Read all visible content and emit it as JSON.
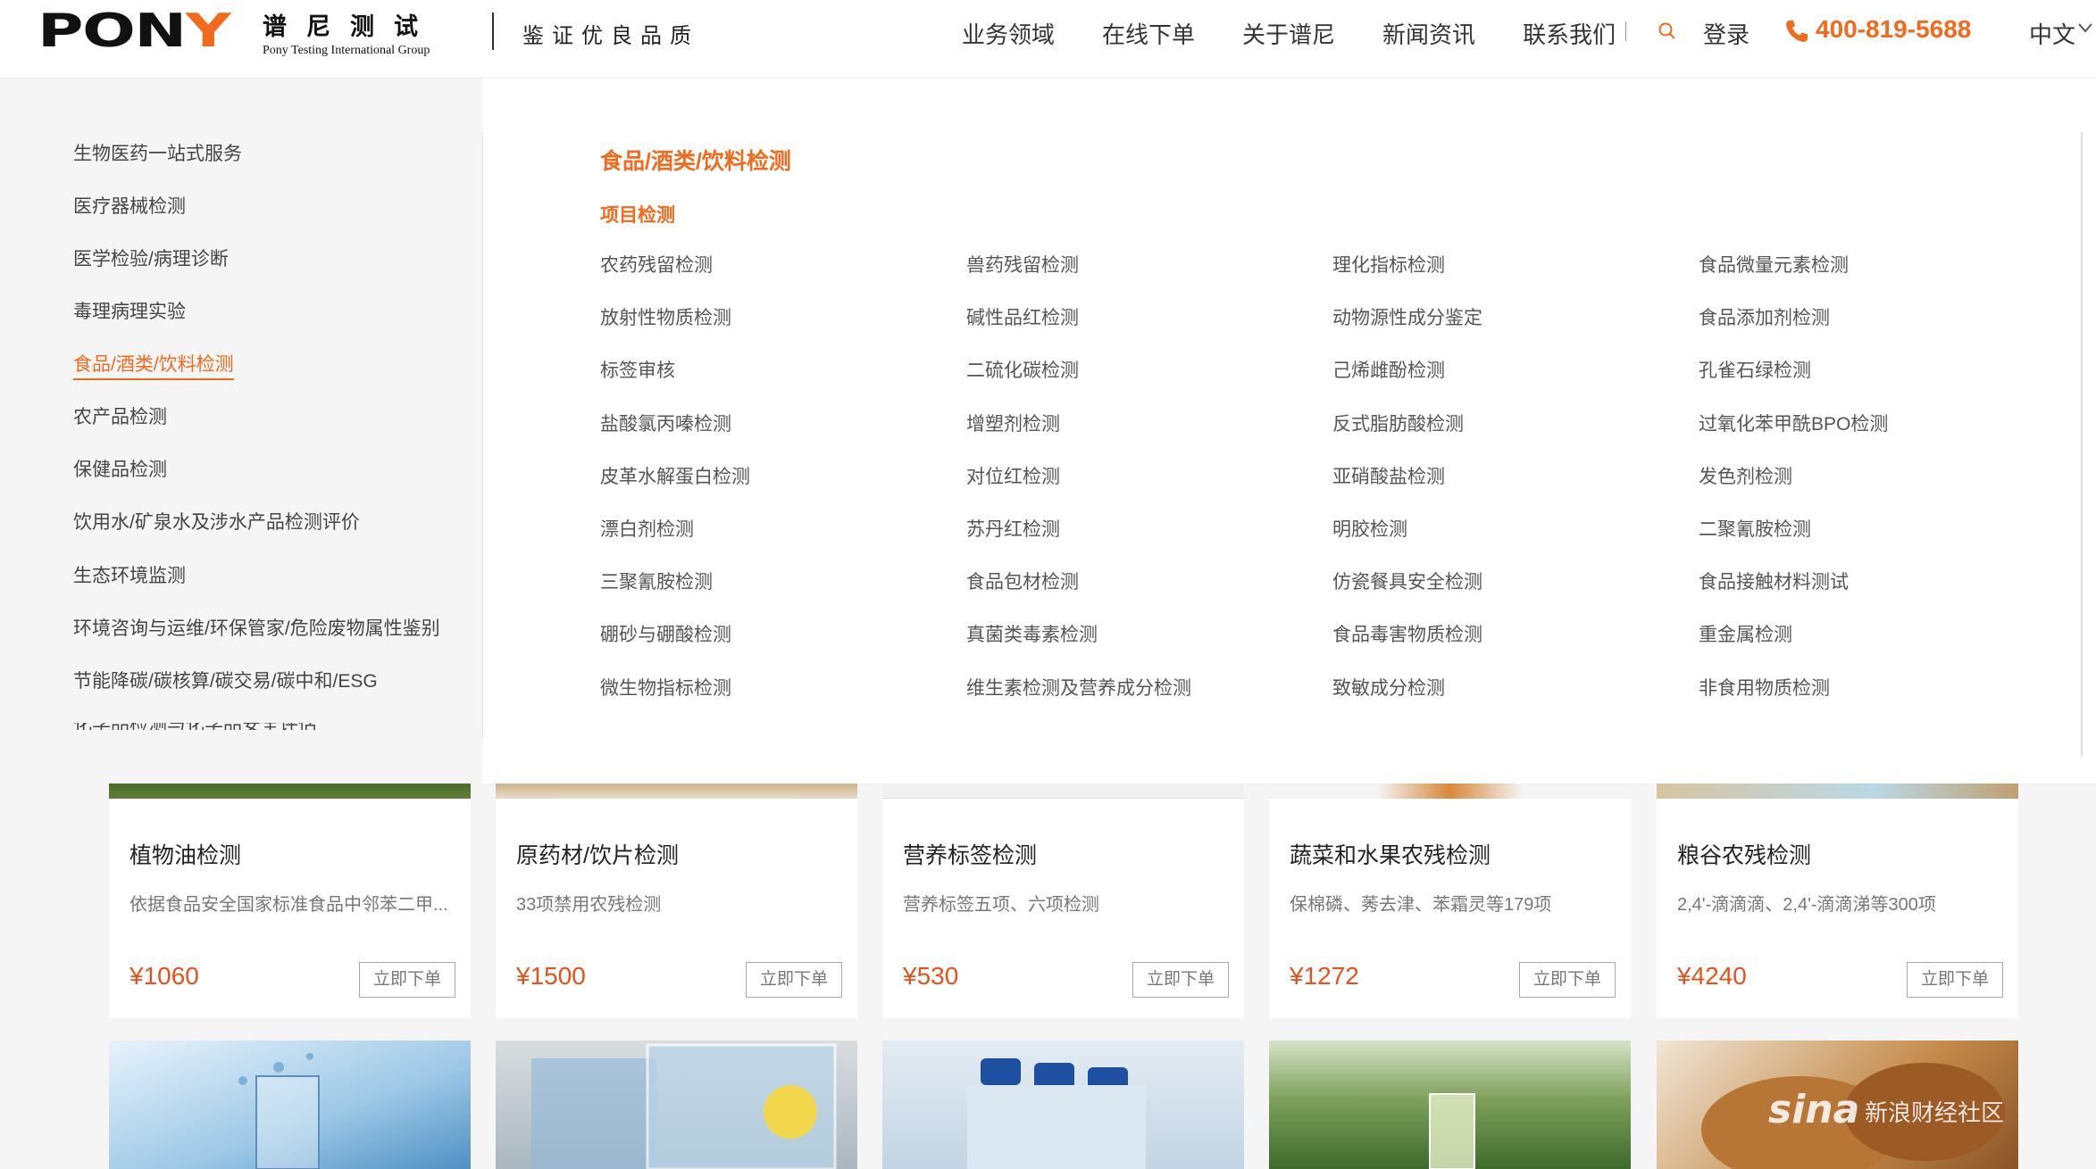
{
  "header": {
    "logo_text": "PONY",
    "logo_cn": "谱尼测试",
    "logo_en": "Pony Testing International Group",
    "slogan": "鉴证优良品质",
    "nav": [
      "业务领域",
      "在线下单",
      "关于谱尼",
      "新闻资讯",
      "联系我们"
    ],
    "login": "登录",
    "phone": "400-819-5688",
    "lang": "中文",
    "accent": "#f26a1b"
  },
  "sidebar": {
    "items": [
      "生物医药一站式服务",
      "医疗器械检测",
      "医学检验/病理诊断",
      "毒理病理实验",
      "食品/酒类/饮料检测",
      "农产品检测",
      "保健品检测",
      "饮用水/矿泉水及涉水产品检测评价",
      "生态环境监测",
      "环境咨询与运维/环保管家/危险废物属性鉴别",
      "节能降碳/碳核算/碳交易/碳中和/ESG"
    ],
    "active_index": 4,
    "partial_item": "化学品检测与化学品安全评估"
  },
  "mega": {
    "title": "食品/酒类/饮料检测",
    "subtitle": "项目检测",
    "items": [
      "农药残留检测",
      "兽药残留检测",
      "理化指标检测",
      "食品微量元素检测",
      "放射性物质检测",
      "碱性品红检测",
      "动物源性成分鉴定",
      "食品添加剂检测",
      "标签审核",
      "二硫化碳检测",
      "己烯雌酚检测",
      "孔雀石绿检测",
      "盐酸氯丙嗪检测",
      "增塑剂检测",
      "反式脂肪酸检测",
      "过氧化苯甲酰BPO检测",
      "皮革水解蛋白检测",
      "对位红检测",
      "亚硝酸盐检测",
      "发色剂检测",
      "漂白剂检测",
      "苏丹红检测",
      "明胶检测",
      "二聚氰胺检测",
      "三聚氰胺检测",
      "食品包材检测",
      "仿瓷餐具安全检测",
      "食品接触材料测试",
      "硼砂与硼酸检测",
      "真菌类毒素检测",
      "食品毒害物质检测",
      "重金属检测",
      "微生物指标检测",
      "维生素检测及营养成分检测",
      "致敏成分检测",
      "非食用物质检测"
    ]
  },
  "cards": [
    {
      "title": "植物油检测",
      "desc": "依据食品安全国家标准食品中邻苯二甲...",
      "price": "¥1060",
      "button": "立即下单"
    },
    {
      "title": "原药材/饮片检测",
      "desc": "33项禁用农残检测",
      "price": "¥1500",
      "button": "立即下单"
    },
    {
      "title": "营养标签检测",
      "desc": "营养标签五项、六项检测",
      "price": "¥530",
      "button": "立即下单"
    },
    {
      "title": "蔬菜和水果农残检测",
      "desc": "保棉磷、莠去津、苯霜灵等179项",
      "price": "¥1272",
      "button": "立即下单"
    },
    {
      "title": "粮谷农残检测",
      "desc": "2,4'-滴滴滴、2,4'-滴滴涕等300项",
      "price": "¥4240",
      "button": "立即下单"
    }
  ],
  "watermark": {
    "brand": "sina",
    "text": "新浪财经社区"
  }
}
